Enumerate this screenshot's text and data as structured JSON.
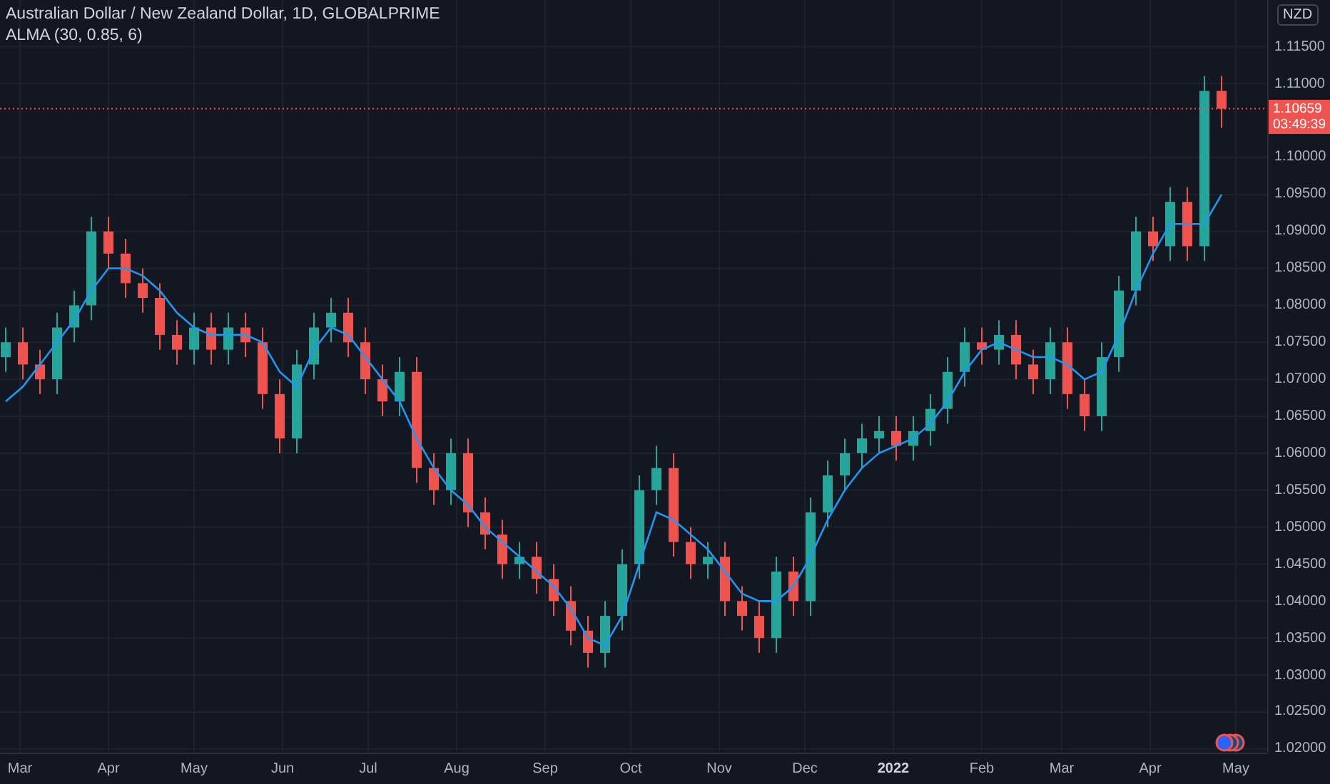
{
  "legend": {
    "symbol": "Australian Dollar / New Zealand Dollar, 1D, GLOBALPRIME"
  },
  "price_scale": {
    "currency": "NZD",
    "last_price": "1.10659",
    "countdown": "03:49:39"
  },
  "chart_data": {
    "type": "candlestick",
    "ylim": [
      1.0195,
      1.1213
    ],
    "xlim": [
      "2021-02-22",
      "2022-05-12"
    ],
    "grid": true,
    "ref_lines": [
      {
        "axis": "y",
        "value": 1.10659,
        "color": "#ef5350"
      }
    ],
    "x": [
      "2021-02-24",
      "2021-03-02",
      "2021-03-08",
      "2021-03-14",
      "2021-03-20",
      "2021-03-26",
      "2021-04-01",
      "2021-04-07",
      "2021-04-13",
      "2021-04-19",
      "2021-04-25",
      "2021-05-01",
      "2021-05-07",
      "2021-05-13",
      "2021-05-19",
      "2021-05-25",
      "2021-05-31",
      "2021-06-06",
      "2021-06-12",
      "2021-06-18",
      "2021-06-24",
      "2021-06-30",
      "2021-07-06",
      "2021-07-12",
      "2021-07-18",
      "2021-07-24",
      "2021-07-30",
      "2021-08-05",
      "2021-08-11",
      "2021-08-17",
      "2021-08-23",
      "2021-08-29",
      "2021-09-04",
      "2021-09-10",
      "2021-09-16",
      "2021-09-22",
      "2021-09-28",
      "2021-10-04",
      "2021-10-10",
      "2021-10-16",
      "2021-10-22",
      "2021-10-28",
      "2021-11-03",
      "2021-11-09",
      "2021-11-15",
      "2021-11-21",
      "2021-11-27",
      "2021-12-03",
      "2021-12-09",
      "2021-12-15",
      "2021-12-21",
      "2021-12-27",
      "2022-01-02",
      "2022-01-08",
      "2022-01-14",
      "2022-01-20",
      "2022-01-26",
      "2022-02-01",
      "2022-02-07",
      "2022-02-13",
      "2022-02-19",
      "2022-02-25",
      "2022-03-03",
      "2022-03-09",
      "2022-03-15",
      "2022-03-21",
      "2022-03-27",
      "2022-04-02",
      "2022-04-08",
      "2022-04-14",
      "2022-04-20",
      "2022-04-26"
    ],
    "ohlc": [
      [
        1.073,
        1.077,
        1.071,
        1.075
      ],
      [
        1.075,
        1.077,
        1.07,
        1.072
      ],
      [
        1.072,
        1.074,
        1.068,
        1.07
      ],
      [
        1.07,
        1.079,
        1.068,
        1.077
      ],
      [
        1.077,
        1.082,
        1.075,
        1.08
      ],
      [
        1.08,
        1.092,
        1.078,
        1.09
      ],
      [
        1.09,
        1.092,
        1.085,
        1.087
      ],
      [
        1.087,
        1.089,
        1.081,
        1.083
      ],
      [
        1.083,
        1.085,
        1.079,
        1.081
      ],
      [
        1.081,
        1.083,
        1.074,
        1.076
      ],
      [
        1.076,
        1.078,
        1.072,
        1.074
      ],
      [
        1.074,
        1.079,
        1.072,
        1.077
      ],
      [
        1.077,
        1.079,
        1.072,
        1.074
      ],
      [
        1.074,
        1.079,
        1.072,
        1.077
      ],
      [
        1.077,
        1.079,
        1.073,
        1.075
      ],
      [
        1.075,
        1.077,
        1.066,
        1.068
      ],
      [
        1.068,
        1.07,
        1.06,
        1.062
      ],
      [
        1.062,
        1.074,
        1.06,
        1.072
      ],
      [
        1.072,
        1.079,
        1.07,
        1.077
      ],
      [
        1.077,
        1.081,
        1.075,
        1.079
      ],
      [
        1.079,
        1.081,
        1.073,
        1.075
      ],
      [
        1.075,
        1.077,
        1.068,
        1.07
      ],
      [
        1.07,
        1.072,
        1.065,
        1.067
      ],
      [
        1.067,
        1.073,
        1.065,
        1.071
      ],
      [
        1.071,
        1.073,
        1.056,
        1.058
      ],
      [
        1.058,
        1.06,
        1.053,
        1.055
      ],
      [
        1.055,
        1.062,
        1.053,
        1.06
      ],
      [
        1.06,
        1.062,
        1.05,
        1.052
      ],
      [
        1.052,
        1.054,
        1.047,
        1.049
      ],
      [
        1.049,
        1.051,
        1.043,
        1.045
      ],
      [
        1.045,
        1.048,
        1.043,
        1.046
      ],
      [
        1.046,
        1.048,
        1.041,
        1.043
      ],
      [
        1.043,
        1.045,
        1.038,
        1.04
      ],
      [
        1.04,
        1.042,
        1.034,
        1.036
      ],
      [
        1.036,
        1.038,
        1.031,
        1.033
      ],
      [
        1.033,
        1.04,
        1.031,
        1.038
      ],
      [
        1.038,
        1.047,
        1.036,
        1.045
      ],
      [
        1.045,
        1.057,
        1.043,
        1.055
      ],
      [
        1.055,
        1.061,
        1.053,
        1.058
      ],
      [
        1.058,
        1.06,
        1.046,
        1.048
      ],
      [
        1.048,
        1.05,
        1.043,
        1.045
      ],
      [
        1.045,
        1.048,
        1.043,
        1.046
      ],
      [
        1.046,
        1.048,
        1.038,
        1.04
      ],
      [
        1.04,
        1.042,
        1.036,
        1.038
      ],
      [
        1.038,
        1.04,
        1.033,
        1.035
      ],
      [
        1.035,
        1.046,
        1.033,
        1.044
      ],
      [
        1.044,
        1.046,
        1.038,
        1.04
      ],
      [
        1.04,
        1.054,
        1.038,
        1.052
      ],
      [
        1.052,
        1.059,
        1.05,
        1.057
      ],
      [
        1.057,
        1.062,
        1.055,
        1.06
      ],
      [
        1.06,
        1.064,
        1.058,
        1.062
      ],
      [
        1.062,
        1.065,
        1.06,
        1.063
      ],
      [
        1.063,
        1.065,
        1.059,
        1.061
      ],
      [
        1.061,
        1.065,
        1.059,
        1.063
      ],
      [
        1.063,
        1.068,
        1.061,
        1.066
      ],
      [
        1.066,
        1.073,
        1.064,
        1.071
      ],
      [
        1.071,
        1.077,
        1.069,
        1.075
      ],
      [
        1.075,
        1.077,
        1.072,
        1.074
      ],
      [
        1.074,
        1.078,
        1.072,
        1.076
      ],
      [
        1.076,
        1.078,
        1.07,
        1.072
      ],
      [
        1.072,
        1.074,
        1.068,
        1.07
      ],
      [
        1.07,
        1.077,
        1.068,
        1.075
      ],
      [
        1.075,
        1.077,
        1.066,
        1.068
      ],
      [
        1.068,
        1.07,
        1.063,
        1.065
      ],
      [
        1.065,
        1.075,
        1.063,
        1.073
      ],
      [
        1.073,
        1.084,
        1.071,
        1.082
      ],
      [
        1.082,
        1.092,
        1.08,
        1.09
      ],
      [
        1.09,
        1.092,
        1.086,
        1.088
      ],
      [
        1.088,
        1.096,
        1.086,
        1.094
      ],
      [
        1.094,
        1.096,
        1.086,
        1.088
      ],
      [
        1.088,
        1.111,
        1.086,
        1.109
      ],
      [
        1.109,
        1.111,
        1.104,
        1.10659
      ]
    ],
    "series": [
      {
        "name": "ALMA (30, 0.85, 6)",
        "type": "line",
        "color": "#2196f3",
        "values": [
          1.067,
          1.069,
          1.072,
          1.075,
          1.078,
          1.082,
          1.085,
          1.085,
          1.084,
          1.082,
          1.079,
          1.077,
          1.076,
          1.076,
          1.076,
          1.075,
          1.071,
          1.069,
          1.074,
          1.077,
          1.076,
          1.073,
          1.07,
          1.067,
          1.062,
          1.058,
          1.055,
          1.053,
          1.05,
          1.048,
          1.046,
          1.044,
          1.042,
          1.039,
          1.035,
          1.034,
          1.038,
          1.045,
          1.052,
          1.051,
          1.049,
          1.047,
          1.044,
          1.041,
          1.04,
          1.04,
          1.042,
          1.046,
          1.051,
          1.055,
          1.058,
          1.06,
          1.061,
          1.062,
          1.064,
          1.067,
          1.071,
          1.074,
          1.075,
          1.074,
          1.073,
          1.073,
          1.072,
          1.07,
          1.071,
          1.076,
          1.082,
          1.087,
          1.091,
          1.091,
          1.091,
          1.095
        ]
      }
    ],
    "xticks": [
      {
        "value": "2021-03-01",
        "label": "Mar"
      },
      {
        "value": "2021-04-01",
        "label": "Apr"
      },
      {
        "value": "2021-05-01",
        "label": "May"
      },
      {
        "value": "2021-06-01",
        "label": "Jun"
      },
      {
        "value": "2021-07-01",
        "label": "Jul"
      },
      {
        "value": "2021-08-01",
        "label": "Aug"
      },
      {
        "value": "2021-09-01",
        "label": "Sep"
      },
      {
        "value": "2021-10-01",
        "label": "Oct"
      },
      {
        "value": "2021-11-01",
        "label": "Nov"
      },
      {
        "value": "2021-12-01",
        "label": "Dec"
      },
      {
        "value": "2022-01-01",
        "label": "2022"
      },
      {
        "value": "2022-02-01",
        "label": "Feb"
      },
      {
        "value": "2022-03-01",
        "label": "Mar"
      },
      {
        "value": "2022-04-01",
        "label": "Apr"
      },
      {
        "value": "2022-05-01",
        "label": "May"
      }
    ],
    "yticks": [
      {
        "value": 1.02,
        "label": "1.02000"
      },
      {
        "value": 1.025,
        "label": "1.02500"
      },
      {
        "value": 1.03,
        "label": "1.03000"
      },
      {
        "value": 1.035,
        "label": "1.03500"
      },
      {
        "value": 1.04,
        "label": "1.04000"
      },
      {
        "value": 1.045,
        "label": "1.04500"
      },
      {
        "value": 1.05,
        "label": "1.05000"
      },
      {
        "value": 1.055,
        "label": "1.05500"
      },
      {
        "value": 1.06,
        "label": "1.06000"
      },
      {
        "value": 1.065,
        "label": "1.06500"
      },
      {
        "value": 1.07,
        "label": "1.07000"
      },
      {
        "value": 1.075,
        "label": "1.07500"
      },
      {
        "value": 1.08,
        "label": "1.08000"
      },
      {
        "value": 1.085,
        "label": "1.08500"
      },
      {
        "value": 1.09,
        "label": "1.09000"
      },
      {
        "value": 1.095,
        "label": "1.09500"
      },
      {
        "value": 1.1,
        "label": "1.10000"
      },
      {
        "value": 1.11,
        "label": "1.11000"
      },
      {
        "value": 1.115,
        "label": "1.11500"
      }
    ]
  }
}
